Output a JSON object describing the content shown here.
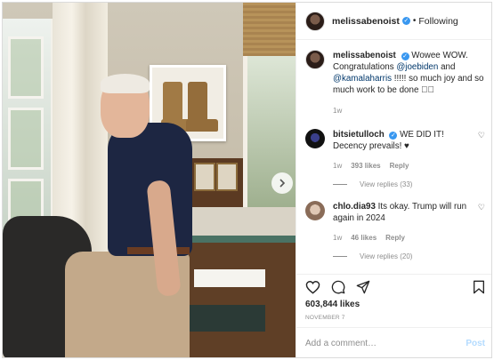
{
  "header": {
    "username": "melissabenoist",
    "follow_label": "Following",
    "separator": "•"
  },
  "caption": {
    "username": "melissabenoist",
    "text_1": "Wowee WOW. Congratulations ",
    "mention_1": "@joebiden",
    "text_2": " and ",
    "mention_2": "@kamalaharris",
    "text_3": " !!!!! so much joy and so much work to be done \u0000\u0000",
    "time": "1w"
  },
  "comments": [
    {
      "username": "bitsietulloch",
      "verified": true,
      "text": "WE DID IT! Decency prevails! ♥",
      "time": "1w",
      "likes": "393 likes",
      "reply_label": "Reply",
      "view_replies": "View replies (33)"
    },
    {
      "username": "chlo.dia93",
      "verified": false,
      "text": "Its okay. Trump will run again in 2024",
      "time": "1w",
      "likes": "46 likes",
      "reply_label": "Reply",
      "view_replies": "View replies (20)"
    }
  ],
  "post": {
    "likes": "603,844 likes",
    "date": "NOVEMBER 7"
  },
  "add_comment": {
    "placeholder": "Add a comment…",
    "post_label": "Post"
  },
  "icons": {
    "verified": "verified-badge-icon",
    "heart": "heart-icon",
    "comment": "comment-icon",
    "share": "share-icon",
    "bookmark": "bookmark-icon",
    "next": "chevron-right-icon"
  },
  "colors": {
    "accent": "#3897f0",
    "mention": "#00376b",
    "muted": "#8e8e8e",
    "post_disabled": "#b3dbff"
  }
}
